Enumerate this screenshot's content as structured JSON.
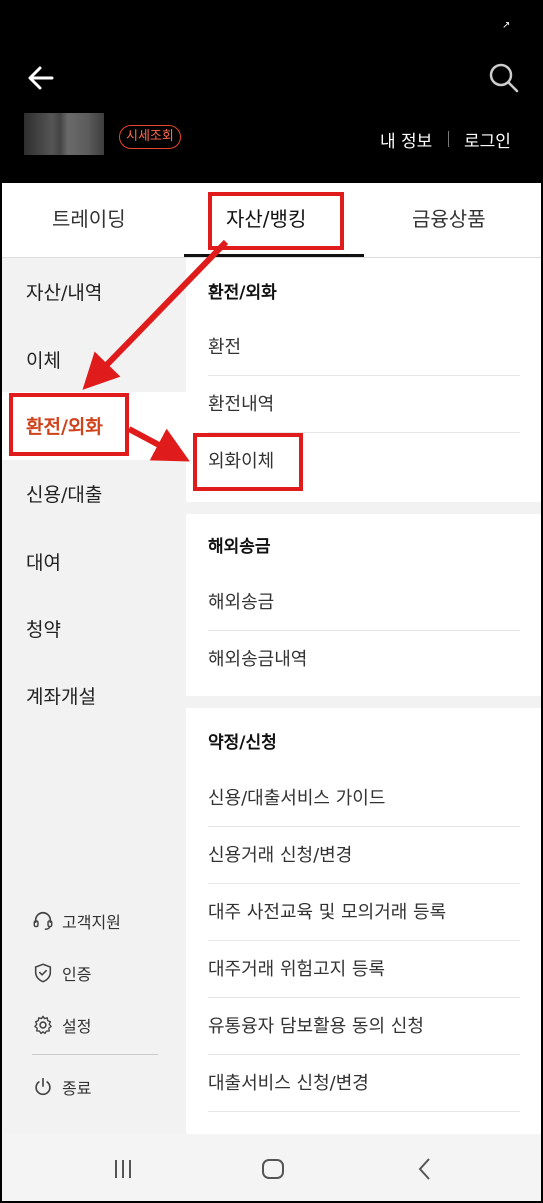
{
  "header": {
    "status_mark": "↗",
    "quote_badge": "시세조회",
    "my_info": "내 정보",
    "login": "로그인"
  },
  "tabs": [
    {
      "label": "트레이딩"
    },
    {
      "label": "자산/뱅킹"
    },
    {
      "label": "금융상품"
    }
  ],
  "sidebar": {
    "items": [
      {
        "label": "자산/내역"
      },
      {
        "label": "이체"
      },
      {
        "label": "환전/외화"
      },
      {
        "label": "신용/대출"
      },
      {
        "label": "대여"
      },
      {
        "label": "청약"
      },
      {
        "label": "계좌개설"
      }
    ],
    "utils": [
      {
        "label": "고객지원",
        "icon": "headset-icon"
      },
      {
        "label": "인증",
        "icon": "shield-check-icon"
      },
      {
        "label": "설정",
        "icon": "gear-icon"
      },
      {
        "label": "종료",
        "icon": "power-icon"
      }
    ]
  },
  "sections": [
    {
      "title": "환전/외화",
      "items": [
        "환전",
        "환전내역",
        "외화이체"
      ]
    },
    {
      "title": "해외송금",
      "items": [
        "해외송금",
        "해외송금내역"
      ]
    },
    {
      "title": "약정/신청",
      "items": [
        "신용/대출서비스 가이드",
        "신용거래 신청/변경",
        "대주 사전교육 및 모의거래 등록",
        "대주거래 위험고지 등록",
        "유통융자 담보활용 동의 신청",
        "대출서비스 신청/변경"
      ]
    }
  ],
  "colors": {
    "accent": "#d0421b",
    "annotation": "#e01b1b"
  }
}
